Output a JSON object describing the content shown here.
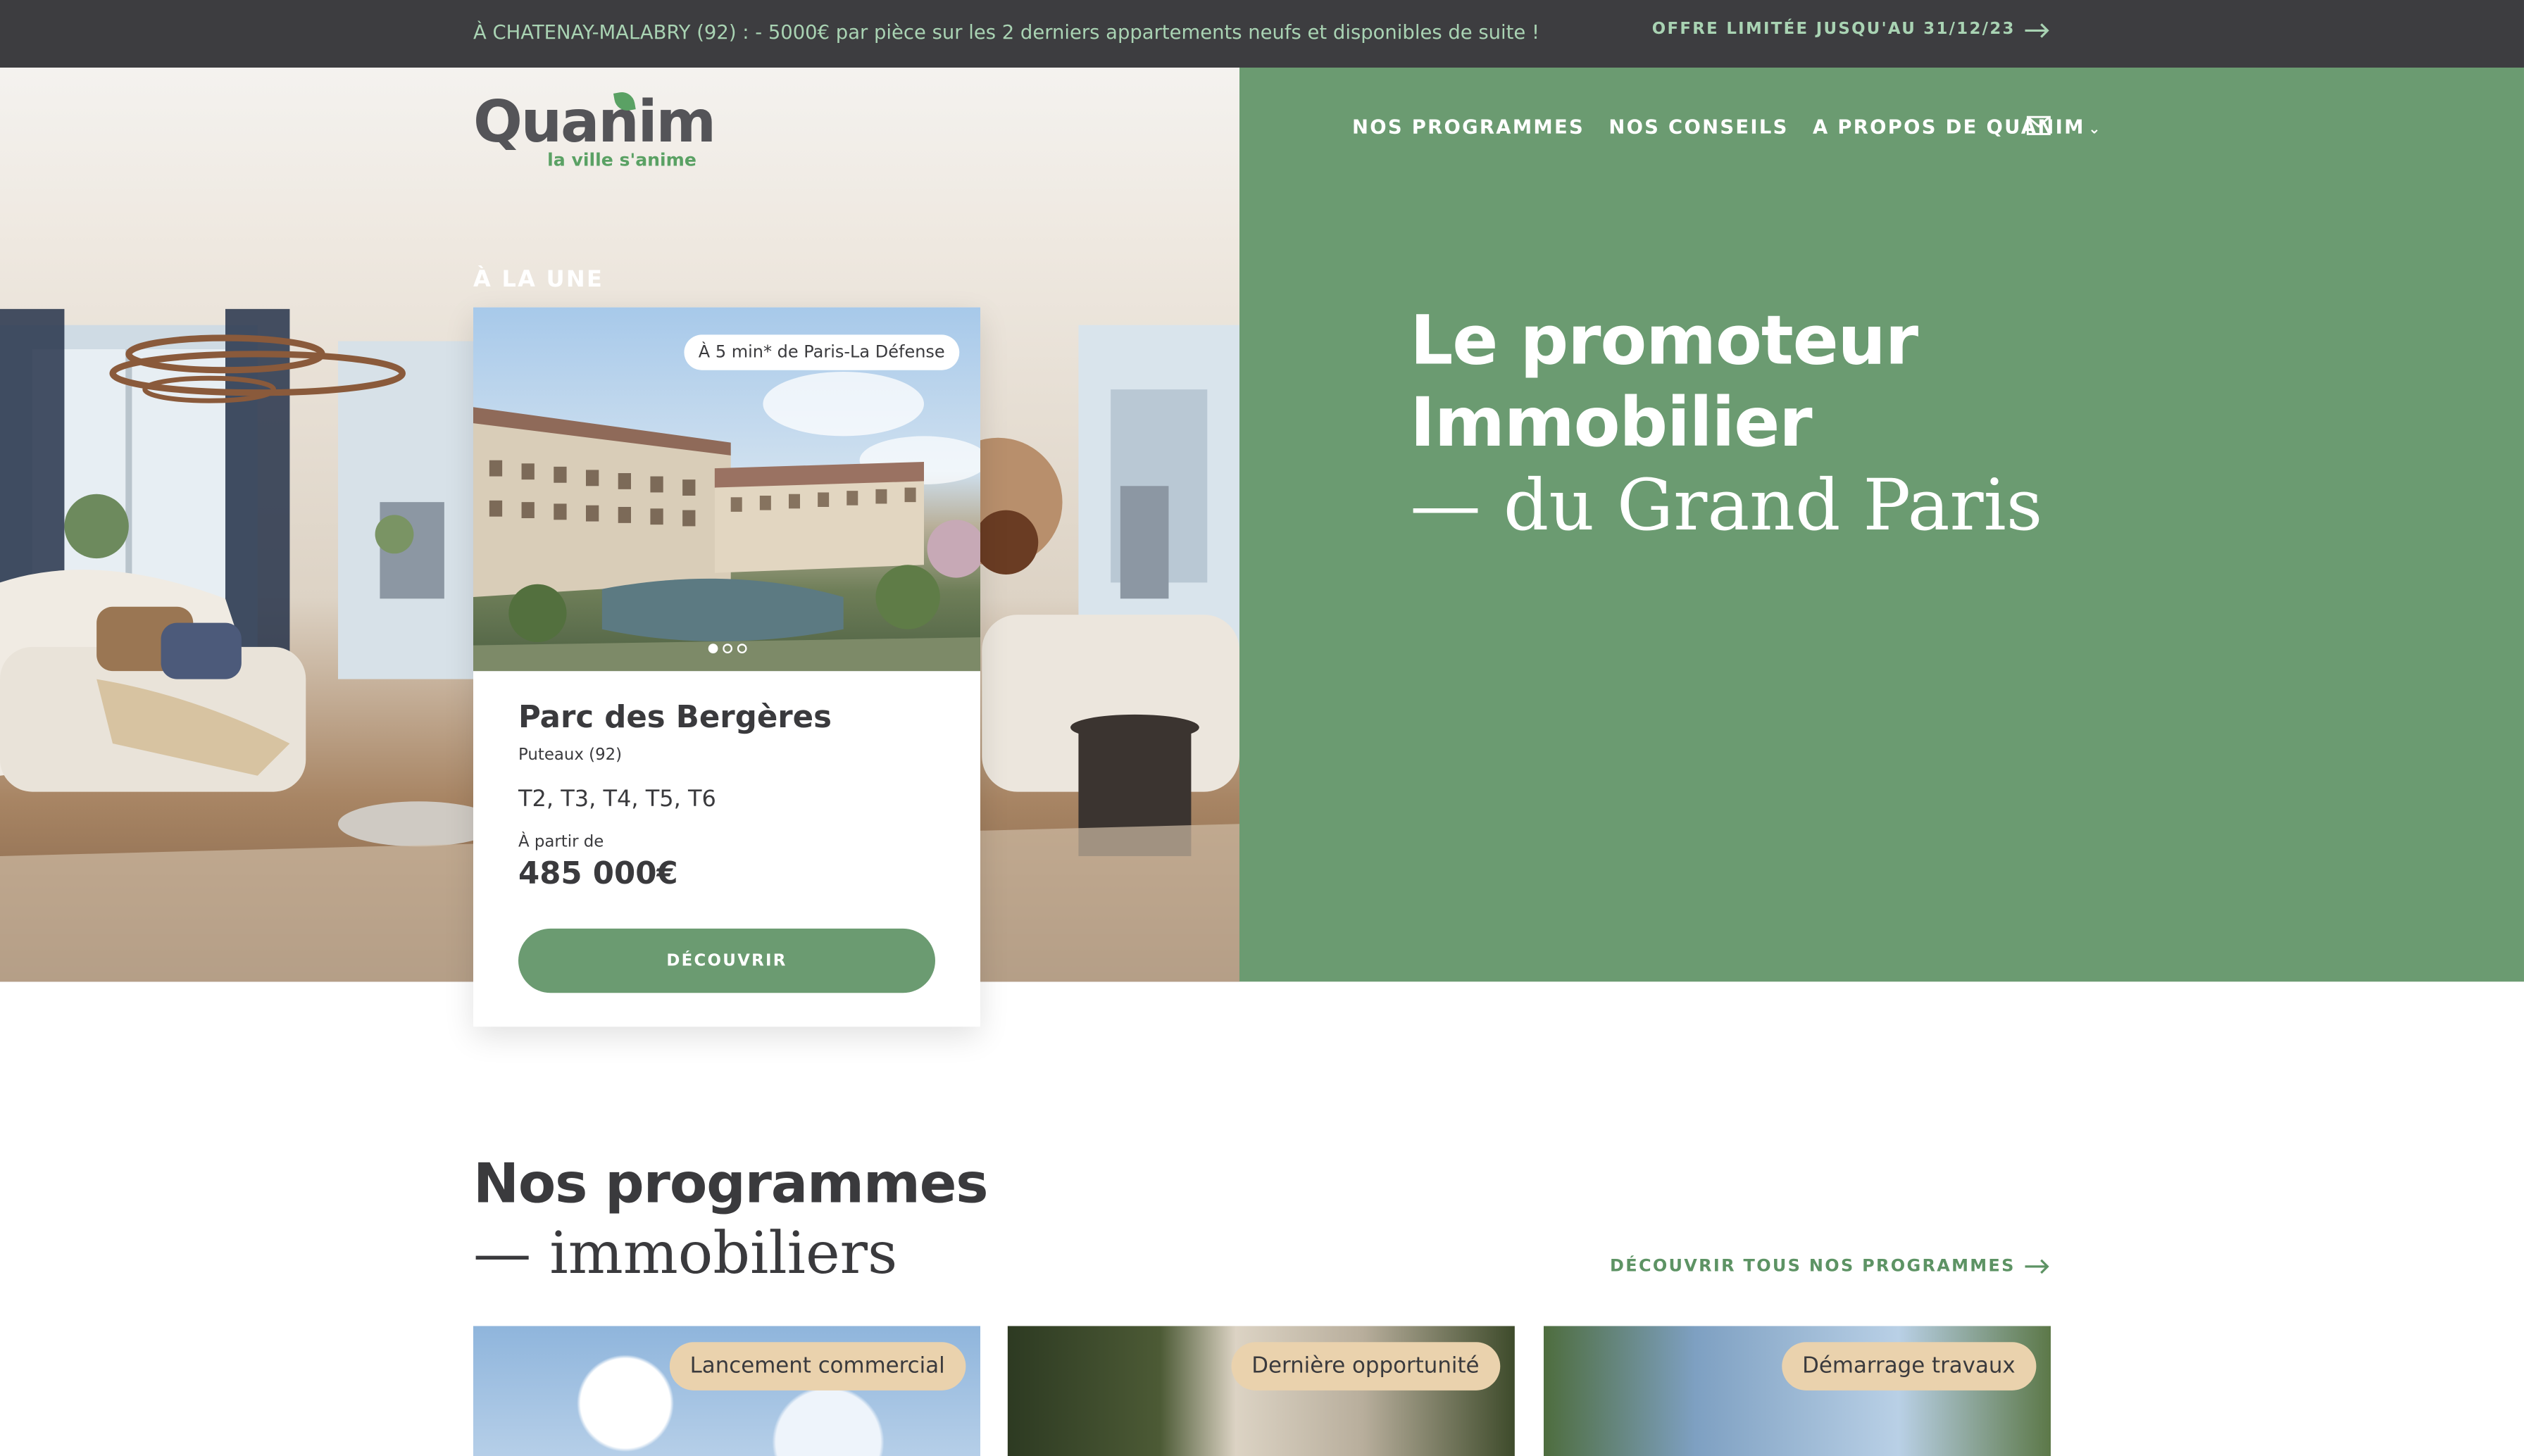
{
  "topbar": {
    "promo": "À CHATENAY-MALABRY (92) : - 5000€ par pièce sur les 2 derniers appartements neufs et disponibles de suite !",
    "offer": "OFFRE LIMITÉE JUSQU'AU 31/12/23"
  },
  "logo": {
    "name": "Quanim",
    "tagline": "la ville s'anime"
  },
  "nav": {
    "items": [
      "NOS PROGRAMMES",
      "NOS CONSEILS",
      "A PROPOS DE QUANIM"
    ],
    "mail_icon": "mail-icon"
  },
  "hero": {
    "line1": "Le promoteur",
    "line2": "Immobilier",
    "line3": "— du Grand Paris",
    "featured_label": "À LA UNE"
  },
  "featured_card": {
    "badge": "À 5 min* de Paris-La Défense",
    "title": "Parc des Bergères",
    "city": "Puteaux (92)",
    "types": "T2, T3, T4, T5, T6",
    "from_label": "À partir de",
    "price": "485 000€",
    "cta": "DÉCOUVRIR",
    "slides": 3,
    "active_slide": 1
  },
  "programs": {
    "title": "Nos programmes",
    "subtitle": "— immobiliers",
    "all_link": "DÉCOUVRIR TOUS NOS PROGRAMMES",
    "cards": [
      {
        "tag": "Lancement commercial"
      },
      {
        "tag": "Dernière opportunité"
      },
      {
        "tag": "Démarrage travaux"
      }
    ]
  },
  "colors": {
    "topbar_bg": "#3d3d40",
    "topbar_text": "#a9d3b3",
    "brand_green": "#6b9b71",
    "logo_green": "#5aa164",
    "tag_beige": "#ead2ad",
    "text_dark": "#3a3a3d"
  }
}
